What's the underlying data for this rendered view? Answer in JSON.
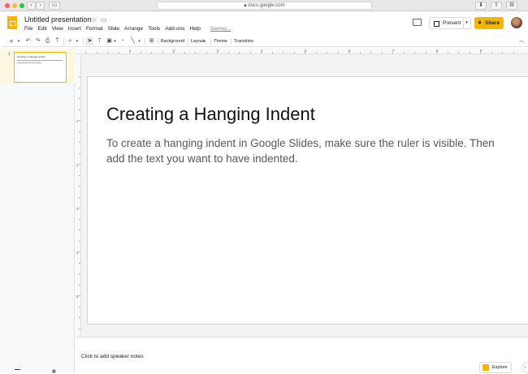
{
  "browser": {
    "url": "docs.google.com",
    "colors": {
      "close": "#ff5f57",
      "minimize": "#febc2e",
      "zoom": "#28c840"
    }
  },
  "app": {
    "title": "Untitled presentation",
    "brand_color": "#f4b400"
  },
  "menu": [
    "File",
    "Edit",
    "View",
    "Insert",
    "Format",
    "Slide",
    "Arrange",
    "Tools",
    "Add-ons",
    "Help"
  ],
  "saving_status": "Saving...",
  "header_buttons": {
    "present": "Present",
    "share": "Share"
  },
  "toolbar": {
    "background": "Background",
    "layout": "Layout",
    "theme": "Theme",
    "transition": "Transition"
  },
  "filmstrip": {
    "slide_number": "1",
    "thumb_title": "Creating a Hanging Indent"
  },
  "ruler": {
    "h_numbers": [
      "1",
      "2",
      "3",
      "4",
      "5",
      "6",
      "7",
      "8",
      "9"
    ],
    "v_numbers": [
      "1",
      "2",
      "3",
      "4",
      "5"
    ]
  },
  "slide": {
    "title": "Creating a Hanging Indent",
    "body": "To create a hanging indent in Google Slides, make sure the ruler is visible. Then add the text you want to have indented."
  },
  "notes_placeholder": "Click to add speaker notes",
  "explore_label": "Explore"
}
